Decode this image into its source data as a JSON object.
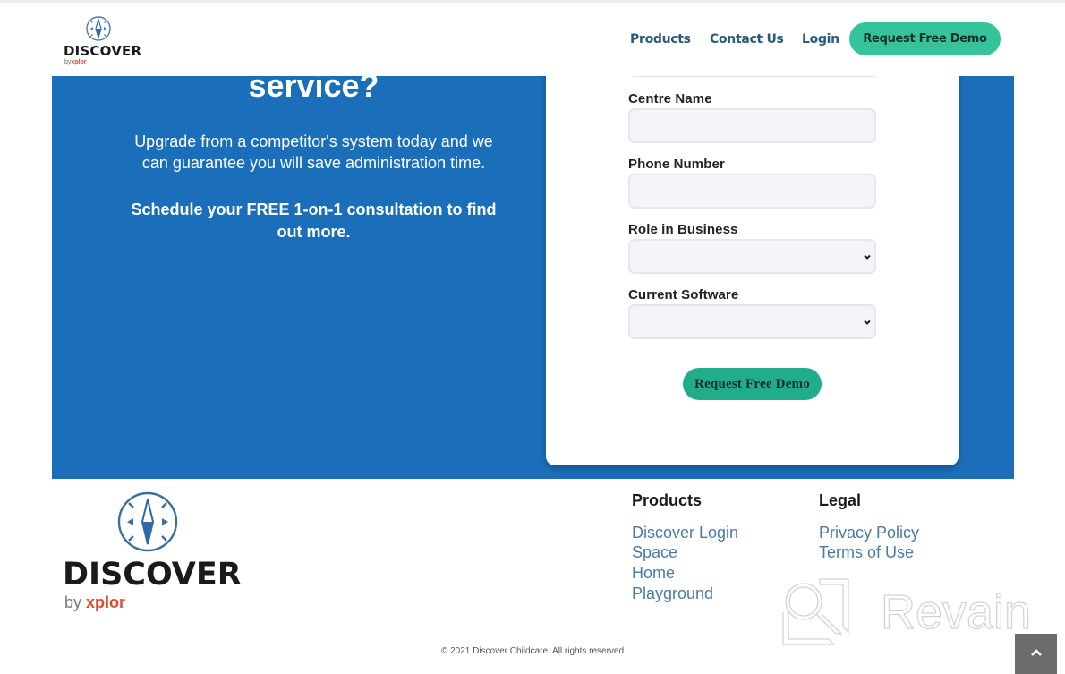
{
  "header": {
    "logo_word": "DISCOVER",
    "logo_by": "by",
    "logo_brand": "xplor",
    "nav": [
      {
        "label": "Products"
      },
      {
        "label": "Contact Us"
      },
      {
        "label": "Login"
      }
    ],
    "cta_label": "Request Free Demo"
  },
  "hero": {
    "title": "service?",
    "paragraph": "Upgrade from a competitor's system today and we can guarantee you will save administration time.",
    "cta_text": "Schedule your FREE 1-on-1 consultation to find out more."
  },
  "form": {
    "fields": [
      {
        "label": "Centre Name",
        "type": "text",
        "value": "",
        "placeholder": ""
      },
      {
        "label": "Phone Number",
        "type": "text",
        "value": "",
        "placeholder": ""
      },
      {
        "label": "Role in Business",
        "type": "select",
        "value": ""
      },
      {
        "label": "Current Software",
        "type": "select",
        "value": ""
      }
    ],
    "submit_label": "Request Free Demo"
  },
  "footer": {
    "logo_word": "DISCOVER",
    "logo_by": "by",
    "logo_brand": "xplor",
    "columns": [
      {
        "heading": "Products",
        "links": [
          "Discover Login",
          "Space",
          "Home",
          "Playground"
        ]
      },
      {
        "heading": "Legal",
        "links": [
          "Privacy Policy",
          "Terms of Use"
        ]
      }
    ],
    "copyright": "© 2021 Discover Childcare. All rights reserved",
    "watermark_text": "Revain",
    "back_to_top_icon": "chevron-up-icon"
  },
  "colors": {
    "hero_blue": "#1b6fba",
    "accent_green": "#34c39a",
    "submit_green": "#21ad8c",
    "nav_text": "#2b5a7e",
    "footer_link": "#4b7aa6",
    "brand_orange": "#e04a2b"
  }
}
